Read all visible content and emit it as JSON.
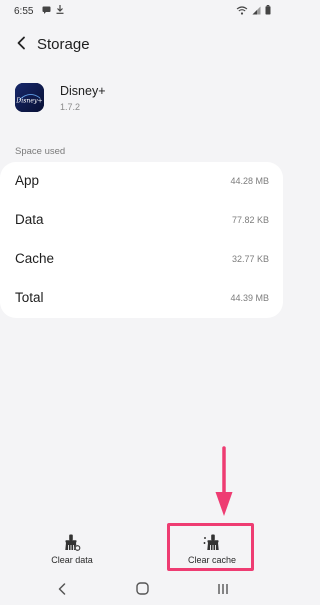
{
  "status_bar": {
    "time": "6:55",
    "icons": [
      "message-icon",
      "download-icon",
      "wifi-icon",
      "signal-icon",
      "battery-icon"
    ]
  },
  "header": {
    "title": "Storage",
    "back_icon": "back-arrow-icon"
  },
  "app": {
    "name": "Disney+",
    "version": "1.7.2",
    "icon_label": "Disney+",
    "icon_bg": "#0d1a49"
  },
  "section": {
    "label": "Space used"
  },
  "storage": {
    "rows": [
      {
        "label": "App",
        "value": "44.28 MB"
      },
      {
        "label": "Data",
        "value": "77.82 KB"
      },
      {
        "label": "Cache",
        "value": "32.77 KB"
      },
      {
        "label": "Total",
        "value": "44.39 MB"
      }
    ]
  },
  "actions": {
    "clear_data": {
      "label": "Clear data",
      "icon": "clear-data-icon"
    },
    "clear_cache": {
      "label": "Clear cache",
      "icon": "clear-cache-icon"
    }
  },
  "annotation": {
    "color": "#ee3c72"
  },
  "nav": {
    "back_icon": "nav-back-icon",
    "home_icon": "nav-home-icon",
    "recents_icon": "nav-recents-icon"
  },
  "colors": {
    "background": "#f4f4f6",
    "card": "#ffffff",
    "secondary_text": "#7d7d7d"
  }
}
